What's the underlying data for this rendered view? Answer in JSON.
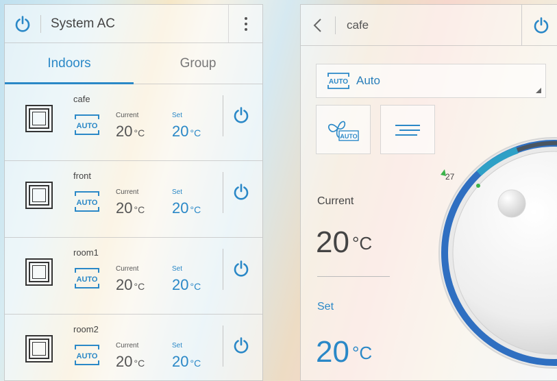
{
  "left": {
    "title": "System AC",
    "tabs": [
      {
        "label": "Indoors",
        "active": true
      },
      {
        "label": "Group",
        "active": false
      }
    ],
    "rows": [
      {
        "name": "cafe",
        "mode_text": "AUTO",
        "current_label": "Current",
        "current_value": "20",
        "set_label": "Set",
        "set_value": "20",
        "unit": "°C"
      },
      {
        "name": "front",
        "mode_text": "AUTO",
        "current_label": "Current",
        "current_value": "20",
        "set_label": "Set",
        "set_value": "20",
        "unit": "°C"
      },
      {
        "name": "room1",
        "mode_text": "AUTO",
        "current_label": "Current",
        "current_value": "20",
        "set_label": "Set",
        "set_value": "20",
        "unit": "°C"
      },
      {
        "name": "room2",
        "mode_text": "AUTO",
        "current_label": "Current",
        "current_value": "20",
        "set_label": "Set",
        "set_value": "20",
        "unit": "°C"
      }
    ]
  },
  "right": {
    "title": "cafe",
    "mode": {
      "icon_text": "AUTO",
      "label": "Auto"
    },
    "fan": {
      "icon_text": "AUTO"
    },
    "current_label": "Current",
    "current_value": "20",
    "set_label": "Set",
    "set_value": "20",
    "unit": "°C",
    "dial_mark": "27"
  },
  "colors": {
    "accent": "#2a88c7",
    "text": "#444444",
    "dial_ring": "#2f6fc1",
    "dial_mark": "#3bb34a"
  },
  "icons": [
    "power-icon",
    "more-vert-icon",
    "back-chevron-icon",
    "indoor-unit-icon",
    "mode-auto-icon",
    "fan-auto-icon",
    "swing-icon"
  ]
}
